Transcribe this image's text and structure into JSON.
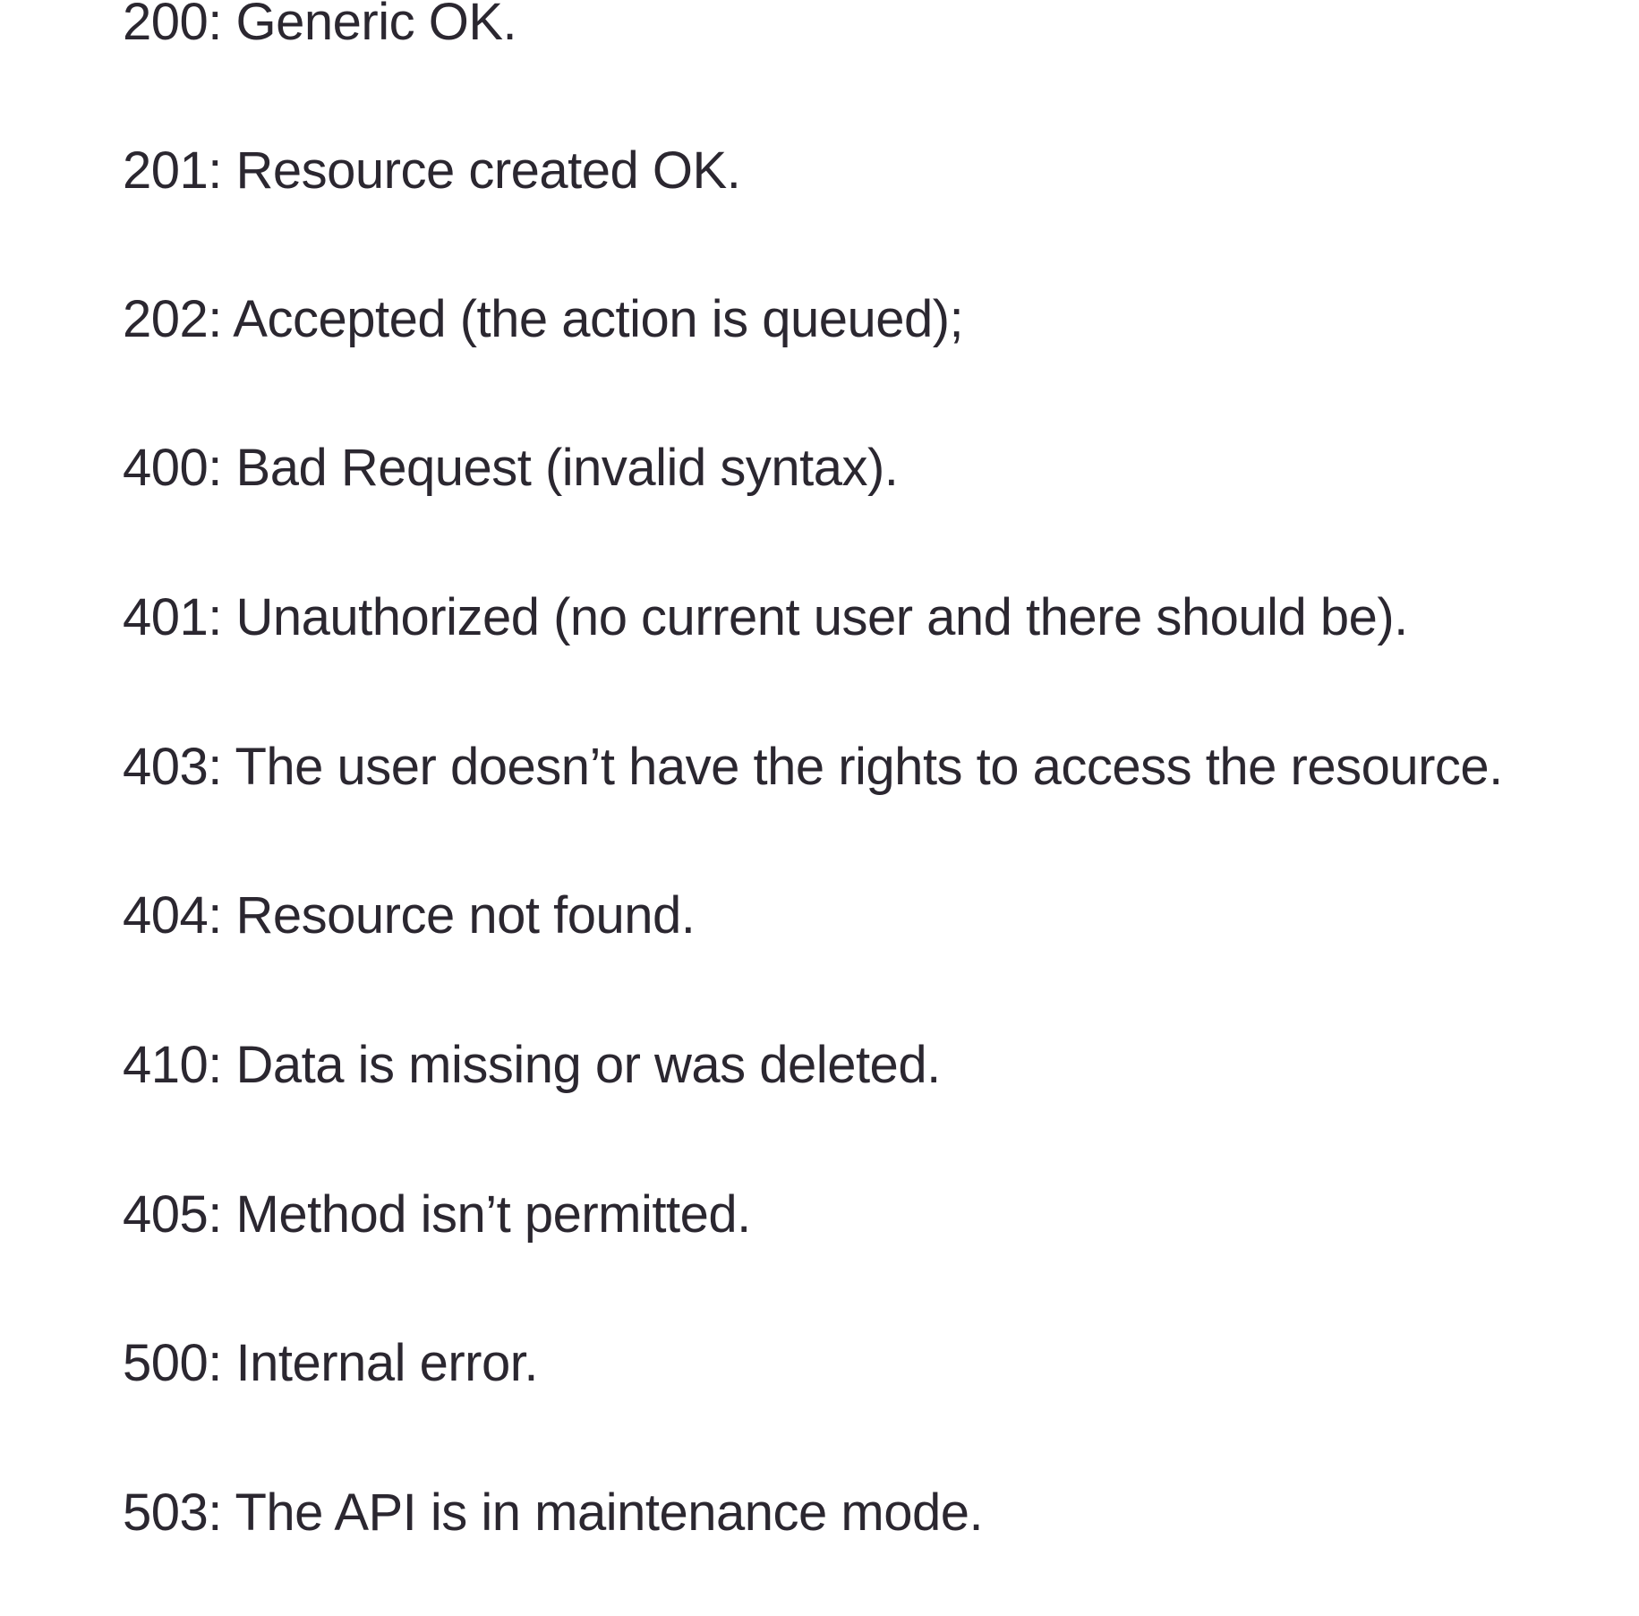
{
  "document": {
    "status_codes": [
      {
        "code": "200:",
        "text": " Generic OK."
      },
      {
        "code": "201:",
        "text": " Resource created OK."
      },
      {
        "code": "202:",
        "text": " Accepted (the action is queued);"
      },
      {
        "code": "400:",
        "text": " Bad Request (invalid syntax)."
      },
      {
        "code": "401:",
        "text": " Unauthorized (no current user and there should be)."
      },
      {
        "code": "403:",
        "text": " The user doesn’t have the rights to access the resource."
      },
      {
        "code": "404:",
        "text": " Resource not found."
      },
      {
        "code": "410:",
        "text": " Data is missing or was deleted."
      },
      {
        "code": "405:",
        "text": " Method isn’t permitted."
      },
      {
        "code": "500:",
        "text": " Internal error."
      },
      {
        "code": "503:",
        "text": " The API is in maintenance mode."
      }
    ]
  }
}
